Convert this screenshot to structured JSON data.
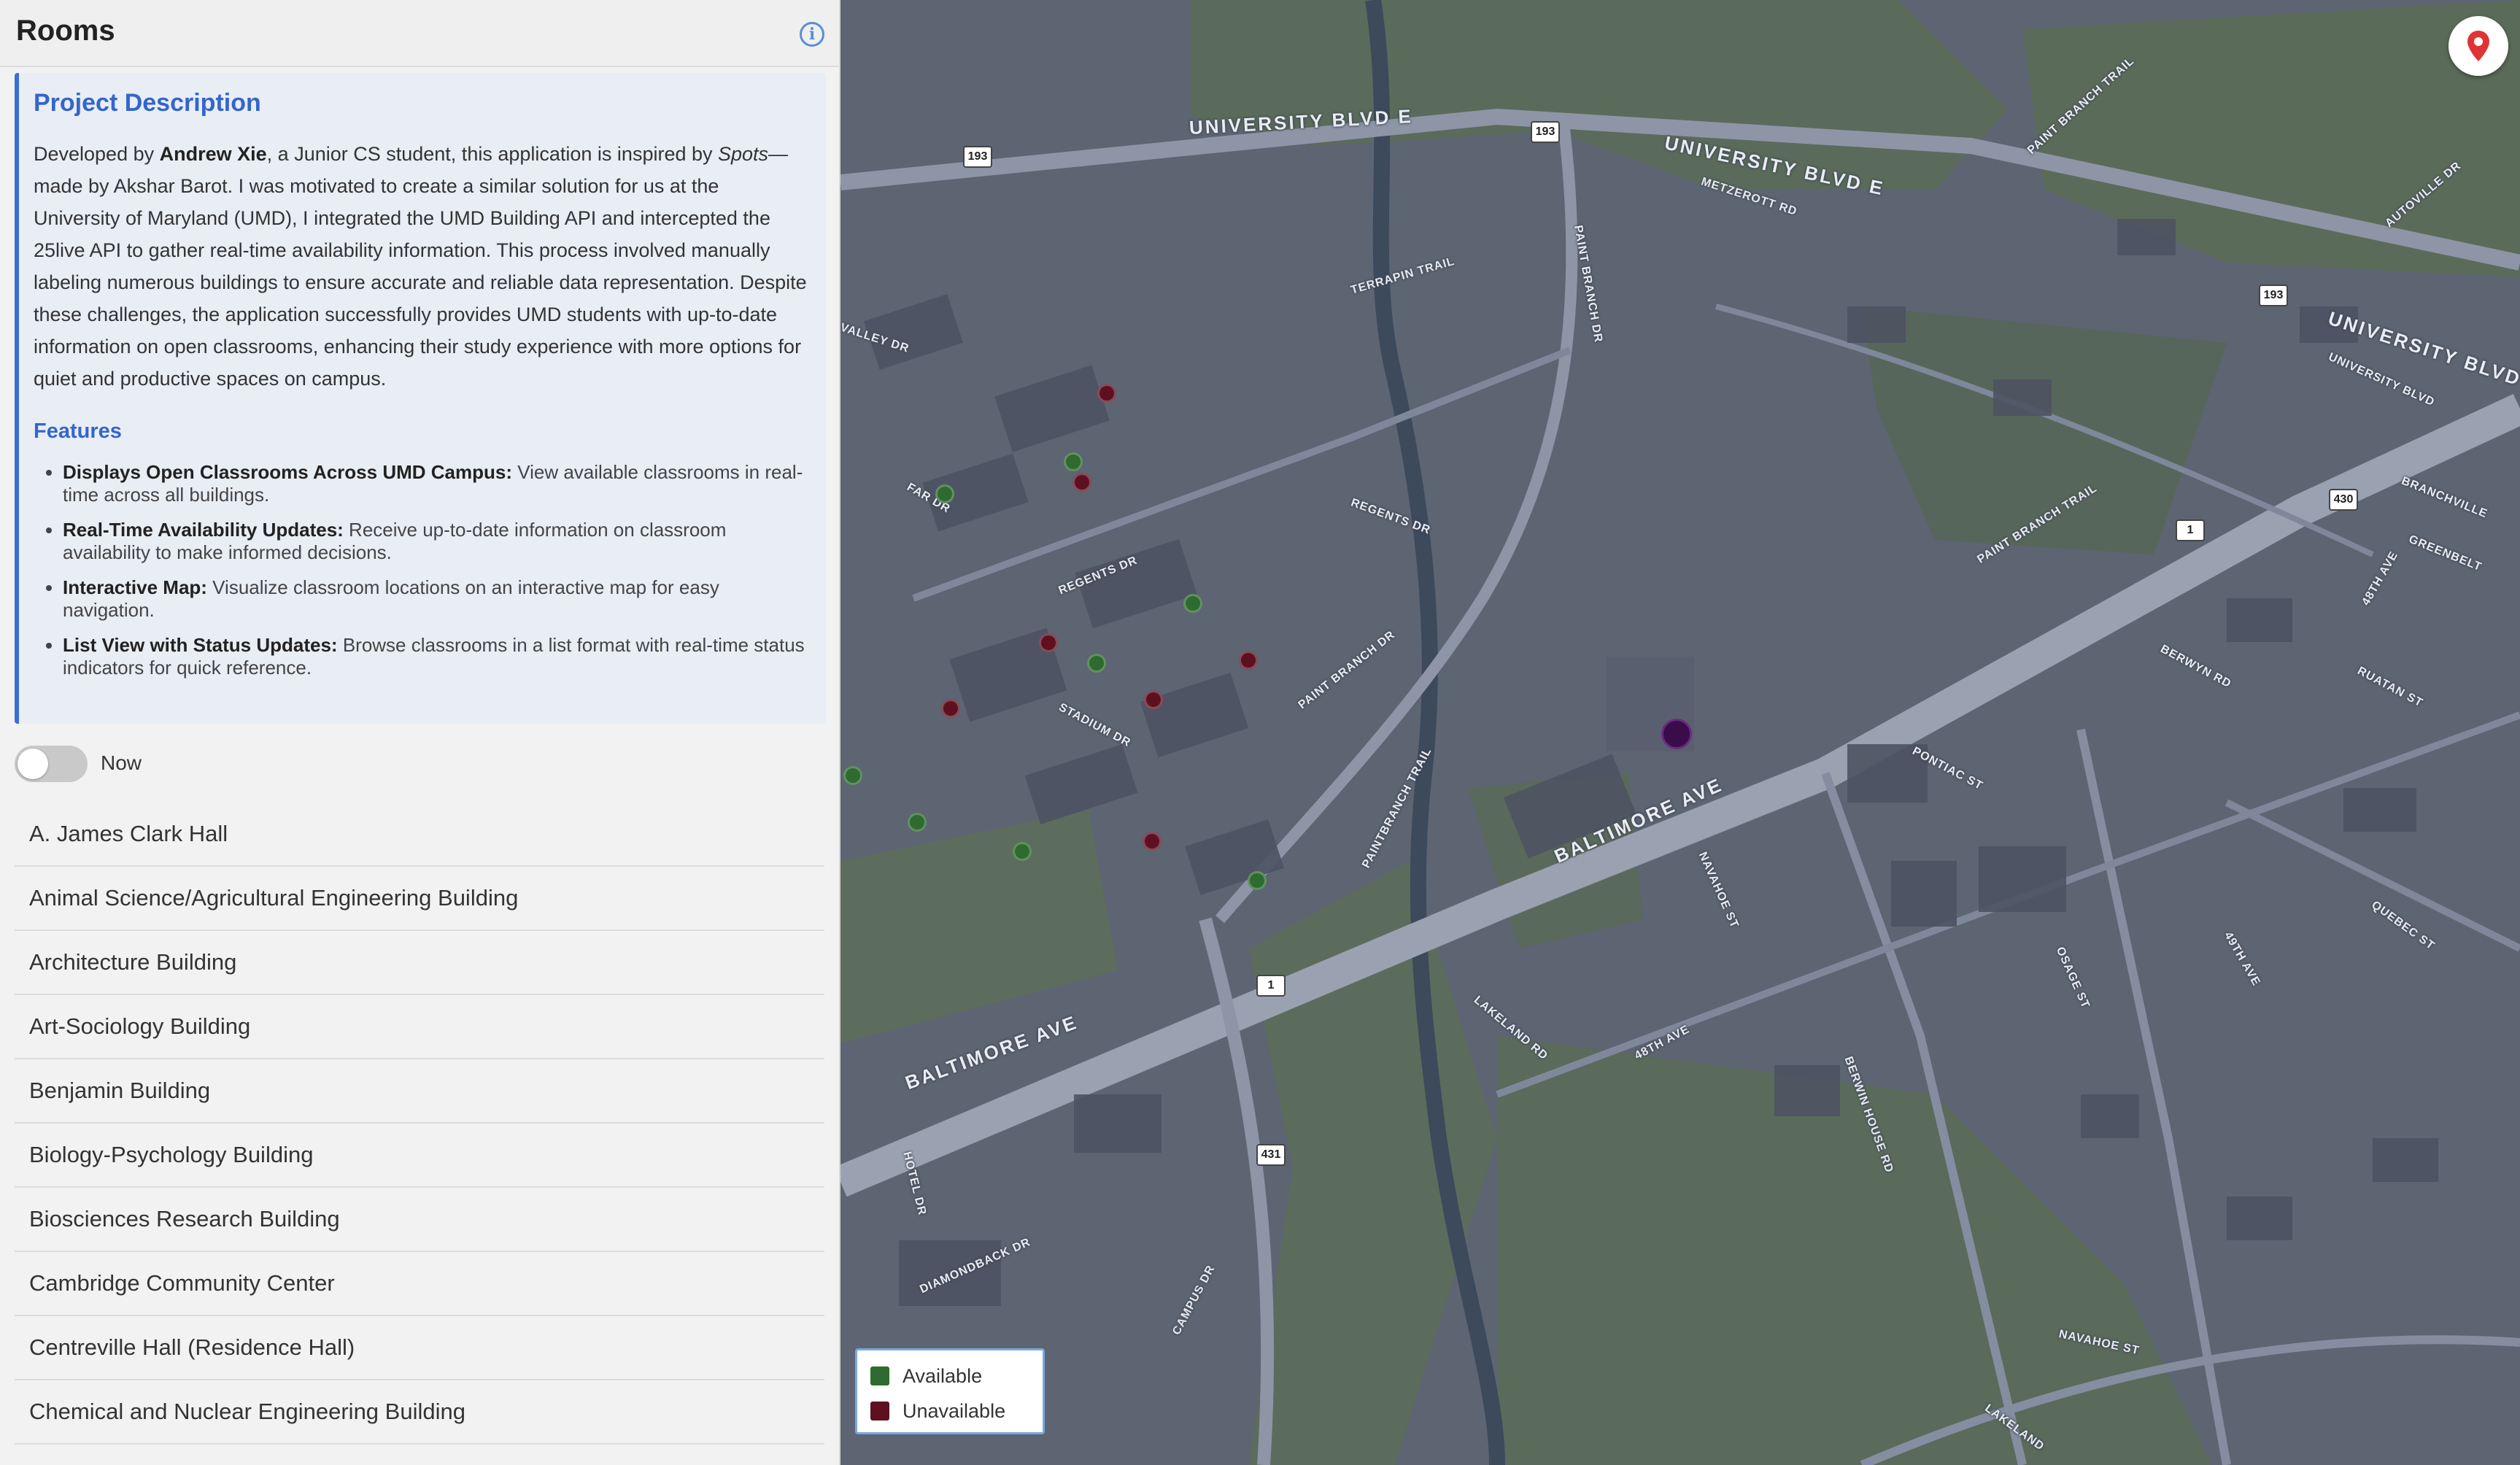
{
  "sidebar": {
    "title": "Rooms",
    "info_icon": "info-icon",
    "description": {
      "title": "Project Description",
      "p1": "Developed by ",
      "author": "Andrew Xie",
      "p2": ", a Junior CS student, this application is inspired by ",
      "inspired_app": "Spots",
      "p3": "—made by Akshar Barot. I was motivated to create a similar solution for us at the University of Maryland (UMD), I integrated the UMD Building API and intercepted the 25live API to gather real-time availability information. This process involved manually labeling numerous buildings to ensure accurate and reliable data representation. Despite these challenges, the application successfully provides UMD students with up-to-date information on open classrooms, enhancing their study experience with more options for quiet and productive spaces on campus.",
      "features_title": "Features",
      "features": [
        {
          "title": "Displays Open Classrooms Across UMD Campus:",
          "text": " View available classrooms in real-time across all buildings."
        },
        {
          "title": "Real-Time Availability Updates:",
          "text": " Receive up-to-date information on classroom availability to make informed decisions."
        },
        {
          "title": "Interactive Map:",
          "text": " Visualize classroom locations on an interactive map for easy navigation."
        },
        {
          "title": "List View with Status Updates:",
          "text": " Browse classrooms in a list format with real-time status indicators for quick reference."
        }
      ]
    },
    "toggle": {
      "label": "Now",
      "on": false
    },
    "buildings": [
      "A. James Clark Hall",
      "Animal Science/Agricultural Engineering Building",
      "Architecture Building",
      "Art-Sociology Building",
      "Benjamin Building",
      "Biology-Psychology Building",
      "Biosciences Research Building",
      "Cambridge Community Center",
      "Centreville Hall (Residence Hall)",
      "Chemical and Nuclear Engineering Building"
    ]
  },
  "map": {
    "road_labels": [
      "UNIVERSITY BLVD E",
      "UNIVERSITY BLVD E",
      "UNIVERSITY BLVD E",
      "METZEROTT RD",
      "TERRAPIN TRAIL",
      "PAINT BRANCH DR",
      "VALLEY DR",
      "FAR DR",
      "REGENTS DR",
      "REGENTS DR",
      "STADIUM DR",
      "PAINT BRANCH DR",
      "PAINTBRANCH TRAIL",
      "PAINT BRANCH TRAIL",
      "PAINT BRANCH TRAIL",
      "BALTIMORE AVE",
      "BALTIMORE AVE",
      "NAVAHOE ST",
      "PONTIAC ST",
      "BERWYN RD",
      "RUATAN ST",
      "48TH AVE",
      "48TH AVE",
      "LAKELAND RD",
      "BERWIN HOUSE RD",
      "OSAGE ST",
      "49TH AVE",
      "QUEBEC ST",
      "HOTEL DR",
      "DIAMONDBACK DR",
      "CAMPUS DR",
      "NAVAHOE ST",
      "LAKELAND",
      "AUTOVILLE DR",
      "BRANCHVILLE",
      "GREENBELT",
      "UNIVERSITY BLVD"
    ],
    "shields": [
      "193",
      "193",
      "193",
      "430",
      "1",
      "1",
      "431"
    ],
    "markers_available": 8,
    "markers_unavailable": 8,
    "locate_icon": "map-pin-icon",
    "legend": {
      "available_label": "Available",
      "unavailable_label": "Unavailable",
      "available_color": "#2e6b2e",
      "unavailable_color": "#5e1020"
    }
  }
}
